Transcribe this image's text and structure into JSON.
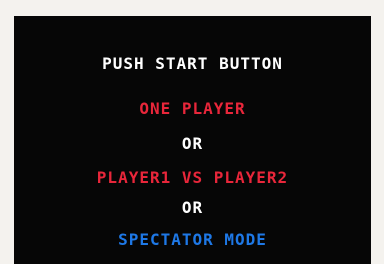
{
  "screen": {
    "prompt": "PUSH START BUTTON",
    "options": [
      {
        "label": "ONE PLAYER",
        "color": "#e8263a"
      },
      {
        "label": "PLAYER1 VS PLAYER2",
        "color": "#e8263a"
      },
      {
        "label": "SPECTATOR MODE",
        "color": "#1e78e6"
      }
    ],
    "separator": "OR"
  },
  "colors": {
    "background": "#060606",
    "text": "#ffffff"
  }
}
